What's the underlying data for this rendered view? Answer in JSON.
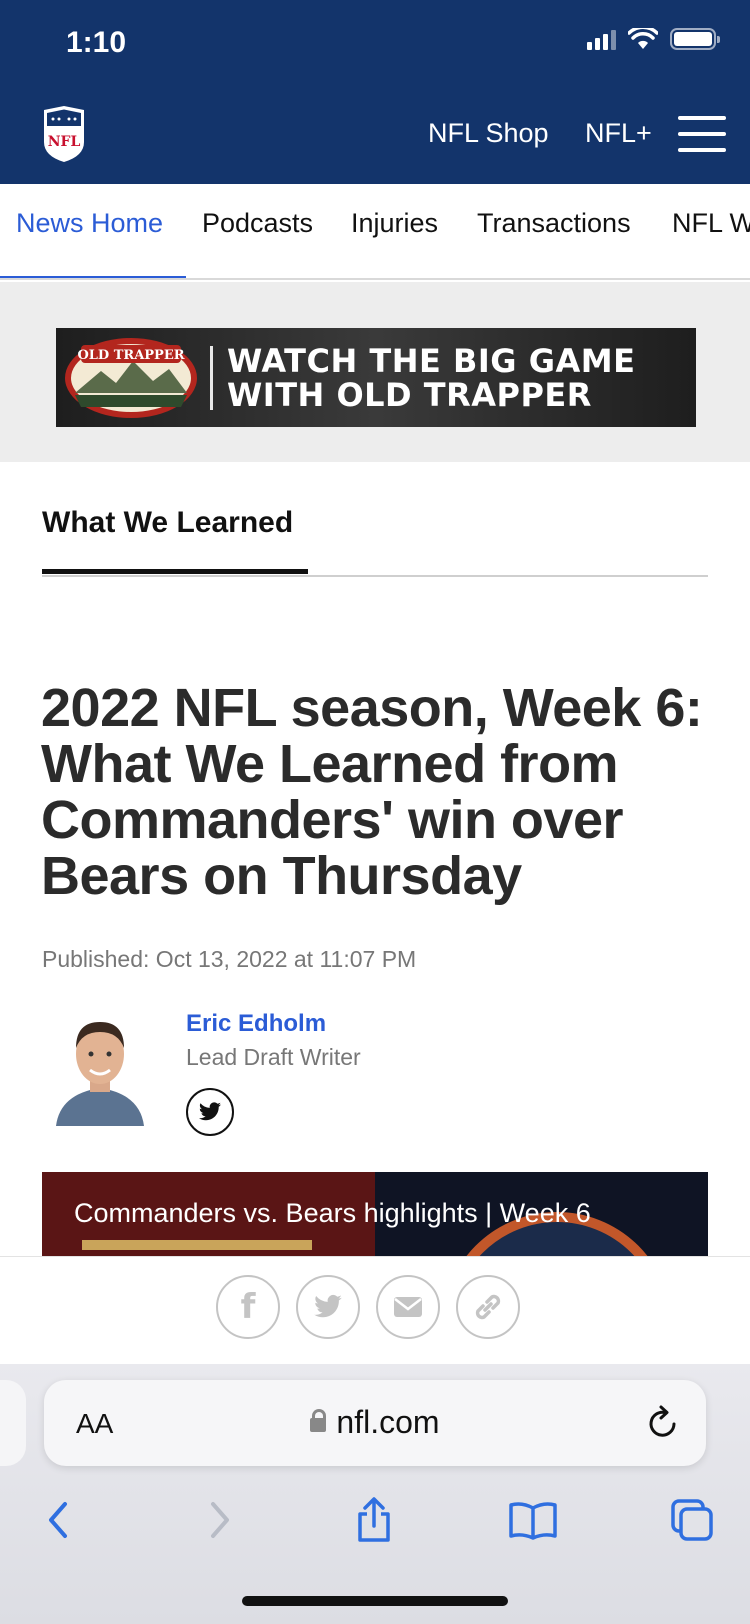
{
  "status_bar": {
    "time": "1:10"
  },
  "header": {
    "logo_alt": "NFL",
    "links": [
      "NFL Shop",
      "NFL+"
    ]
  },
  "subnav": {
    "items": [
      "News Home",
      "Podcasts",
      "Injuries",
      "Transactions",
      "NFL W"
    ],
    "active_index": 0
  },
  "ad": {
    "brand": "OLD TRAPPER",
    "line1": "WATCH THE BIG GAME",
    "line2": "WITH OLD TRAPPER"
  },
  "section_tab": "What We Learned",
  "article": {
    "headline": "2022 NFL season, Week 6: What We Learned from Commanders' win over Bears on Thursday",
    "published": "Published: Oct 13, 2022 at 11:07 PM"
  },
  "author": {
    "name": "Eric Edholm",
    "role": "Lead Draft Writer"
  },
  "video": {
    "title": "Commanders vs. Bears highlights | Week 6"
  },
  "share": {
    "buttons": [
      "facebook",
      "twitter",
      "email",
      "link"
    ]
  },
  "browser": {
    "text_size_label": "AA",
    "url": "nfl.com"
  },
  "colors": {
    "header_bg": "#13346b",
    "accent_blue": "#2b5cd6"
  }
}
